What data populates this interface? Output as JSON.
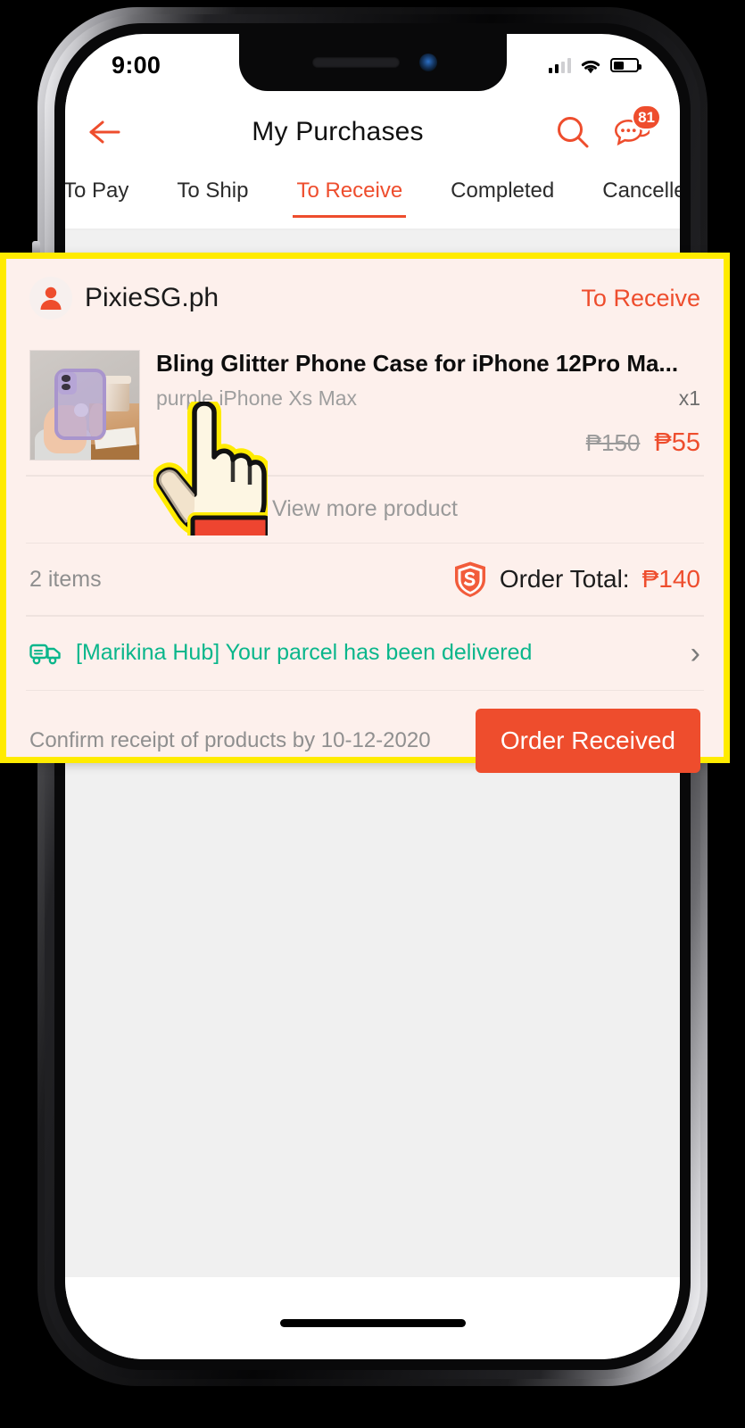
{
  "status_bar": {
    "time": "9:00",
    "signal_icon": "signal-bars-icon",
    "wifi_icon": "wifi-icon",
    "battery_icon": "battery-icon"
  },
  "app_bar": {
    "back_icon": "back-arrow-icon",
    "title": "My Purchases",
    "search_icon": "search-icon",
    "chat_icon": "chat-bubble-icon",
    "chat_badge": "81"
  },
  "tabs": [
    {
      "label": "To Pay",
      "active": false
    },
    {
      "label": "To Ship",
      "active": false
    },
    {
      "label": "To Receive",
      "active": true
    },
    {
      "label": "Completed",
      "active": false
    },
    {
      "label": "Cancelled",
      "active": false
    }
  ],
  "order_card": {
    "shop_avatar_icon": "user-avatar-icon",
    "shop_name": "PixieSG.ph",
    "status": "To Receive",
    "product": {
      "image_alt": "bling-glitter-phone-case-photo",
      "title": "Bling Glitter Phone Case for iPhone 12Pro Ma...",
      "variant": "purple,iPhone Xs Max",
      "quantity": "x1",
      "price_original": "₱150",
      "price_discounted": "₱55"
    },
    "view_more_label": "View more product",
    "items_count": "2 items",
    "guarantee_icon": "shopee-shield-icon",
    "total_label": "Order Total:",
    "total_amount": "₱140",
    "delivery_icon": "delivery-truck-icon",
    "delivery_status": "[Marikina Hub] Your parcel has been delivered",
    "delivery_chevron_icon": "chevron-right-icon",
    "confirm_text": "Confirm receipt of products by 10-12-2020",
    "order_received_label": "Order Received"
  },
  "cursor": {
    "icon": "pointing-hand-cursor"
  },
  "colors": {
    "brand_orange": "#ee4d2d",
    "highlight_yellow": "#ffeb00",
    "card_background": "#fdf0ec",
    "delivery_green": "#0ab68b",
    "page_background": "#f0f0f0"
  }
}
